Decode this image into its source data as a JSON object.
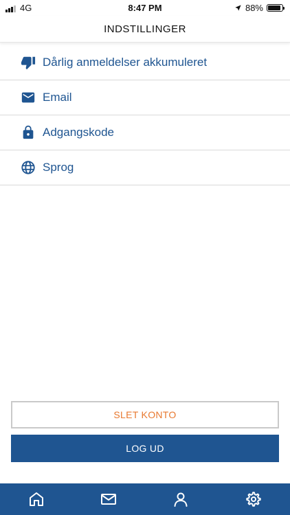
{
  "status_bar": {
    "network": "4G",
    "time": "8:47 PM",
    "battery_percent": "88%",
    "battery_level": 0.88,
    "signal_bars_active": 3,
    "signal_bars_total": 4
  },
  "header": {
    "title": "INDSTILLINGER"
  },
  "settings": {
    "items": [
      {
        "label": "Dårlig anmeldelser akkumuleret",
        "icon": "thumbs-down-icon"
      },
      {
        "label": "Email",
        "icon": "envelope-icon"
      },
      {
        "label": "Adgangskode",
        "icon": "lock-icon"
      },
      {
        "label": "Sprog",
        "icon": "globe-icon"
      }
    ]
  },
  "buttons": {
    "delete_account": "SLET KONTO",
    "logout": "LOG UD"
  },
  "tab_bar": {
    "tabs": [
      "home-icon",
      "mail-icon",
      "profile-icon",
      "settings-gear-icon"
    ]
  },
  "colors": {
    "primary": "#1f5591",
    "danger_text": "#e8782f",
    "divider": "#d9d9d9"
  }
}
